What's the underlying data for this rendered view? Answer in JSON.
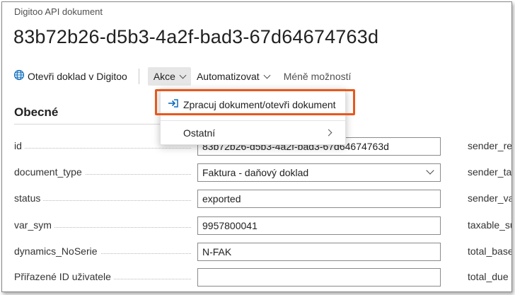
{
  "header": {
    "caption": "Digitoo API dokument",
    "title": "83b72b26-d5b3-4a2f-bad3-67d64674763d"
  },
  "actionbar": {
    "open_in_digitoo": "Otevři doklad v Digitoo",
    "actions": "Akce",
    "automate": "Automatizovat",
    "fewer_options": "Méně možností"
  },
  "actions_menu": {
    "items": [
      {
        "label": "Zpracuj dokument/otevři dokument",
        "icon": "enter-arrow-icon",
        "highlighted": true
      },
      {
        "label": "Ostatní",
        "has_submenu": true
      }
    ]
  },
  "section": {
    "title": "Obecné",
    "fields": [
      {
        "label": "id",
        "value": "83b72b26-d5b3-4a2f-bad3-67d64674763d"
      },
      {
        "label": "document_type",
        "value": "Faktura - daňový doklad",
        "type": "select"
      },
      {
        "label": "status",
        "value": "exported"
      },
      {
        "label": "var_sym",
        "value": "9957800041"
      },
      {
        "label": "dynamics_NoSerie",
        "value": "N-FAK"
      },
      {
        "label": "Přiřazené ID uživatele",
        "value": ""
      }
    ],
    "right_labels": [
      "sender_re",
      "sender_ta",
      "sender_va",
      "taxable_su",
      "total_base",
      "total_due"
    ]
  },
  "colors": {
    "accent": "#0f6cbd",
    "highlight_border": "#e8581c"
  }
}
